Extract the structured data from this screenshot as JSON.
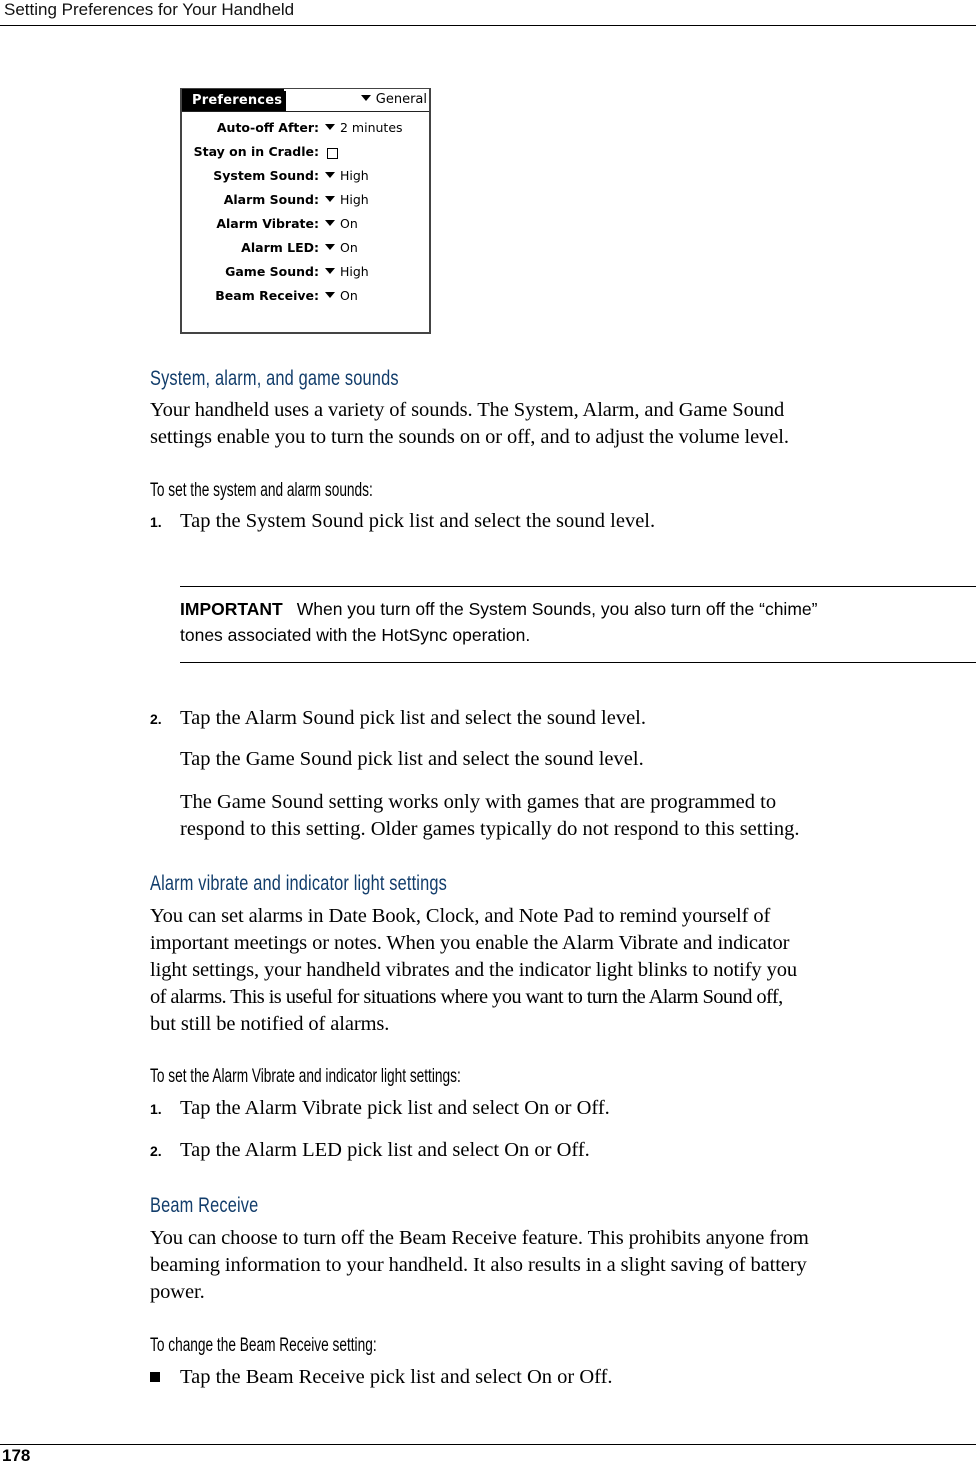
{
  "header": {
    "running_title": "Setting Preferences for Your Handheld"
  },
  "footer": {
    "page_number": "178"
  },
  "palm_screen": {
    "title": "Preferences",
    "category": "General",
    "rows": [
      {
        "label": "Auto-off After:",
        "type": "picklist",
        "value": "2 minutes"
      },
      {
        "label": "Stay on in Cradle:",
        "type": "checkbox",
        "checked": false
      },
      {
        "label": "System Sound:",
        "type": "picklist",
        "value": "High"
      },
      {
        "label": "Alarm Sound:",
        "type": "picklist",
        "value": "High"
      },
      {
        "label": "Alarm Vibrate:",
        "type": "picklist",
        "value": "On"
      },
      {
        "label": "Alarm LED:",
        "type": "picklist",
        "value": "On"
      },
      {
        "label": "Game Sound:",
        "type": "picklist",
        "value": "High"
      },
      {
        "label": "Beam Receive:",
        "type": "picklist",
        "value": "On"
      }
    ]
  },
  "sections": {
    "sounds": {
      "heading": "System, alarm, and game sounds",
      "body_lines": [
        "Your handheld uses a variety of sounds. The System, Alarm, and Game Sound",
        "settings enable you to turn the sounds on or off, and to adjust the volume level."
      ],
      "procedure_heading": "To set the system and alarm sounds:",
      "steps": [
        {
          "num": "1.",
          "text": "Tap the System Sound pick list and select the sound level."
        },
        {
          "num": "2.",
          "text": "Tap the Alarm Sound pick list and select the sound level."
        }
      ],
      "note": {
        "label": "IMPORTANT",
        "line1": "When you turn off the System Sounds, you also turn off the “chime”",
        "line2": "tones associated with the HotSync operation."
      },
      "step2_cont1": "Tap the Game Sound pick list and select the sound level.",
      "step2_cont2_lines": [
        "The Game Sound setting works only with games that are programmed to",
        "respond to this setting. Older games typically do not respond to this setting."
      ]
    },
    "alarm_vibrate": {
      "heading": "Alarm vibrate and indicator light settings",
      "body_lines": [
        "You can set alarms in Date Book, Clock, and Note Pad to remind yourself of",
        "important meetings or notes. When you enable the Alarm Vibrate and indicator",
        "light settings, your handheld vibrates and the indicator light blinks to notify you",
        "of alarms. This is useful for situations where you want to turn the Alarm Sound off,",
        "but still be notified of alarms."
      ],
      "procedure_heading": "To set the Alarm Vibrate and indicator light settings:",
      "steps": [
        {
          "num": "1.",
          "text": "Tap the Alarm Vibrate pick list and select On or Off."
        },
        {
          "num": "2.",
          "text": "Tap the Alarm LED pick list and select On or Off."
        }
      ]
    },
    "beam_receive": {
      "heading": "Beam Receive",
      "body_lines": [
        "You can choose to turn off the Beam Receive feature. This prohibits anyone from",
        "beaming information to your handheld. It also results in a slight saving of battery",
        "power."
      ],
      "procedure_heading": "To change the Beam Receive setting:",
      "bullet_text": "Tap the Beam Receive pick list and select On or Off."
    }
  }
}
